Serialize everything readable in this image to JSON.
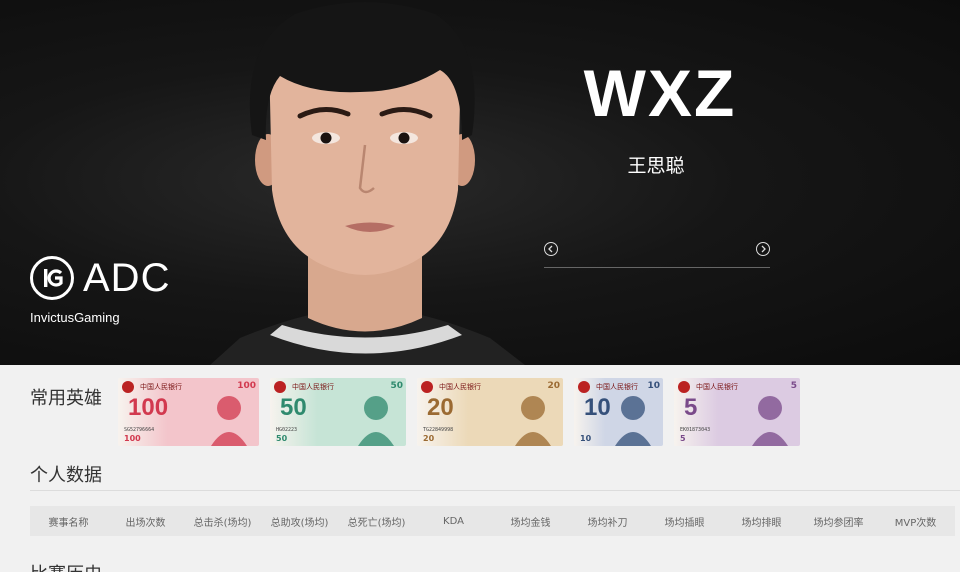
{
  "hero_banner": {
    "role": "ADC",
    "team_name": "InvictusGaming",
    "player_id": "WXZ",
    "player_name": "王思聪"
  },
  "favorite_heroes": {
    "title": "常用英雄",
    "items": [
      {
        "denomination": "100",
        "bank": "中国人民银行",
        "serial": "SG52796664",
        "color": "#d2394f",
        "bg": "#f3c5cb"
      },
      {
        "denomination": "50",
        "bank": "中国人民银行",
        "serial": "HG02223",
        "color": "#2f8a6e",
        "bg": "#c6e4d6"
      },
      {
        "denomination": "20",
        "bank": "中国人民银行",
        "serial": "TG22849998",
        "color": "#9b6a32",
        "bg": "#ecd9b8"
      },
      {
        "denomination": "10",
        "bank": "中国人民银行",
        "serial": "",
        "color": "#35507a",
        "bg": "#cfd6e6"
      },
      {
        "denomination": "5",
        "bank": "中国人民银行",
        "serial": "EK01873043",
        "color": "#7a4a8a",
        "bg": "#dccbe2"
      }
    ]
  },
  "personal_data": {
    "title": "个人数据",
    "columns": [
      "赛事名称",
      "出场次数",
      "总击杀(场均)",
      "总助攻(场均)",
      "总死亡(场均)",
      "KDA",
      "场均金钱",
      "场均补刀",
      "场均插眼",
      "场均排眼",
      "场均参团率",
      "MVP次数"
    ]
  },
  "match_history": {
    "title": "比赛历史"
  },
  "icons": {
    "team_logo": "ig-logo-icon",
    "prev": "chevron-left-circle-icon",
    "next": "chevron-right-circle-icon"
  }
}
